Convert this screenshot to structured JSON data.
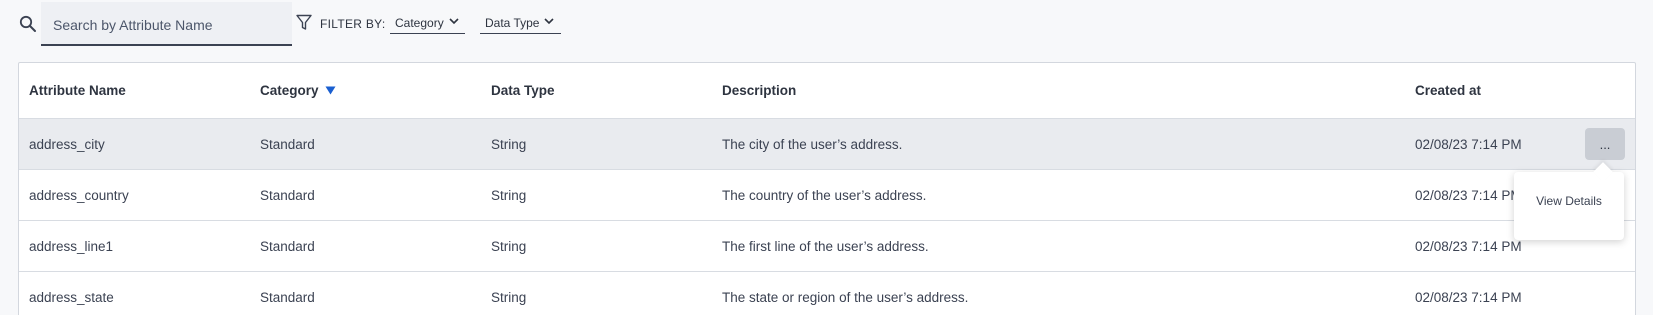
{
  "search": {
    "placeholder": "Search by Attribute Name",
    "value": ""
  },
  "filter": {
    "label": "FILTER BY:",
    "category_label": "Category",
    "datatype_label": "Data Type"
  },
  "table": {
    "columns": {
      "name": "Attribute Name",
      "category": "Category",
      "datatype": "Data Type",
      "description": "Description",
      "created": "Created at"
    },
    "sort_column": "Category",
    "sort_direction": "descending",
    "rows": [
      {
        "name": "address_city",
        "category": "Standard",
        "datatype": "String",
        "description": "The city of the user’s address.",
        "created": "02/08/23 7:14 PM"
      },
      {
        "name": "address_country",
        "category": "Standard",
        "datatype": "String",
        "description": "The country of the user’s address.",
        "created": "02/08/23 7:14 PM"
      },
      {
        "name": "address_line1",
        "category": "Standard",
        "datatype": "String",
        "description": "The first line of the user’s address.",
        "created": "02/08/23 7:14 PM"
      },
      {
        "name": "address_state",
        "category": "Standard",
        "datatype": "String",
        "description": "The state or region of the user’s address.",
        "created": "02/08/23 7:14 PM"
      }
    ]
  },
  "row_actions": {
    "more_label": "...",
    "menu_item": "View Details"
  },
  "colors": {
    "accent": "#1a5fd0",
    "hover_row": "#e9ebef",
    "more_button": "#c9cdd4"
  }
}
